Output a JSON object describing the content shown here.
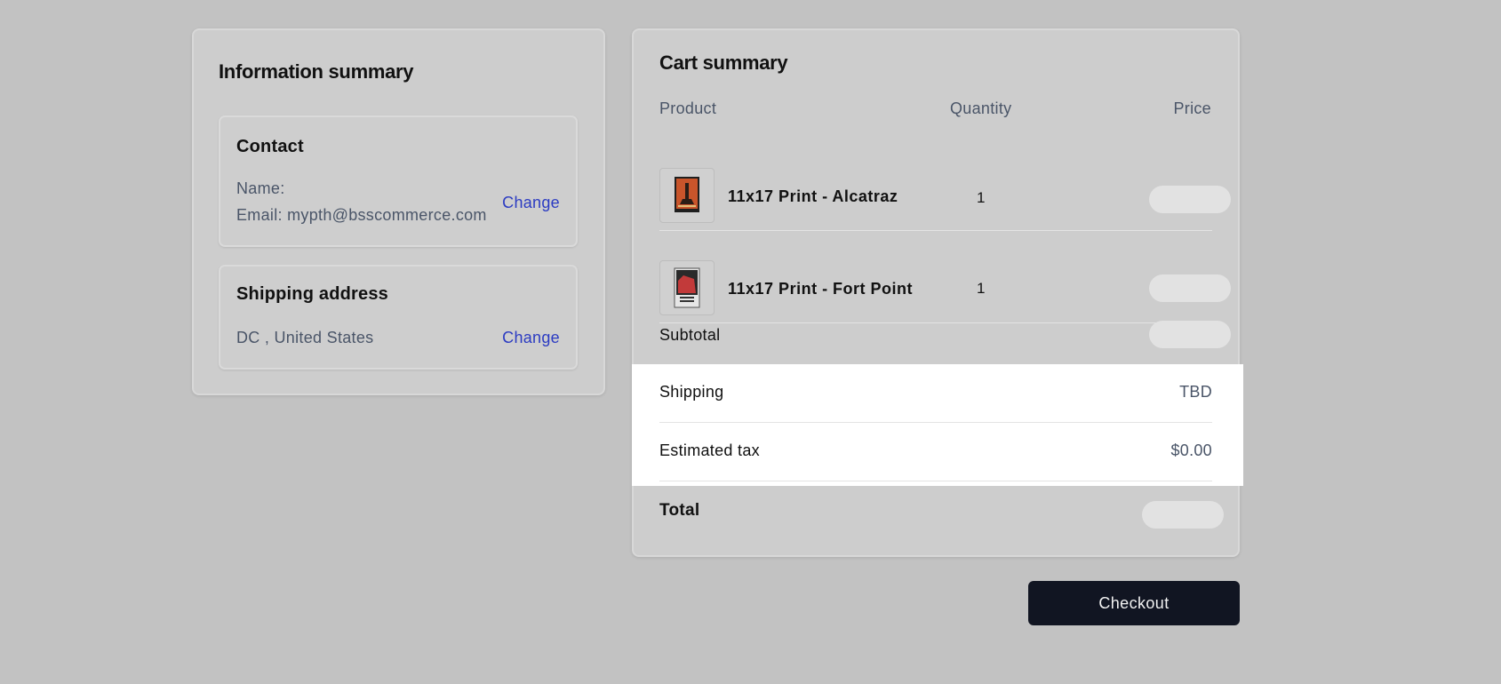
{
  "info": {
    "title": "Information summary",
    "contact": {
      "title": "Contact",
      "name_line": "Name:",
      "email_line": "Email: mypth@bsscommerce.com",
      "change_label": "Change"
    },
    "shipping": {
      "title": "Shipping address",
      "address": "DC , United States",
      "change_label": "Change"
    }
  },
  "cart": {
    "title": "Cart summary",
    "headers": {
      "product": "Product",
      "quantity": "Quantity",
      "price": "Price"
    },
    "items": [
      {
        "name": "11x17 Print - Alcatraz",
        "quantity": "1",
        "thumb_icon": "alcatraz-print-thumbnail"
      },
      {
        "name": "11x17 Print - Fort Point",
        "quantity": "1",
        "thumb_icon": "fort-point-print-thumbnail"
      }
    ],
    "subtotal_label": "Subtotal",
    "shipping_label": "Shipping",
    "shipping_value": "TBD",
    "tax_label": "Estimated tax",
    "tax_value": "$0.00",
    "total_label": "Total"
  },
  "checkout_label": "Checkout",
  "colors": {
    "background": "#c2c2c2",
    "panel": "#cdcdcd",
    "link": "#2b3bc2",
    "checkout_button": "#111522",
    "highlight": "#ffffff"
  }
}
